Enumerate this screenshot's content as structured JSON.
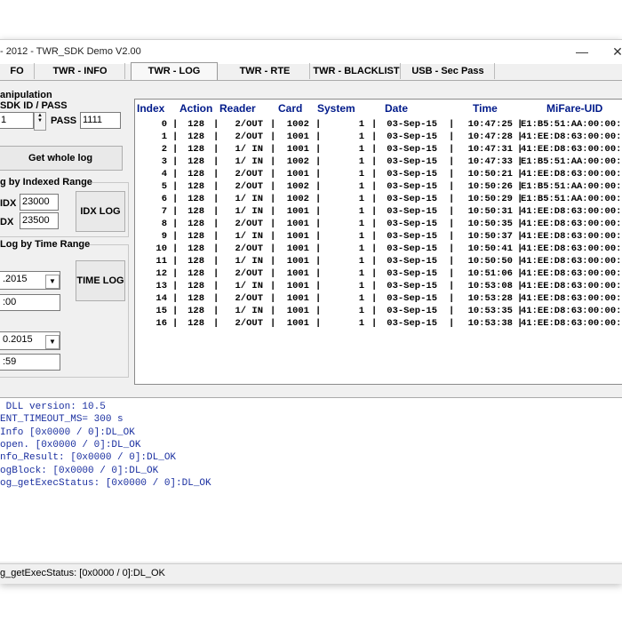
{
  "window": {
    "title": "- 2012  - TWR_SDK Demo V2.00",
    "minimize": "—",
    "close": "✕"
  },
  "tabs": [
    {
      "label": "FO"
    },
    {
      "label": "TWR - INFO"
    },
    {
      "label": "TWR - LOG"
    },
    {
      "label": "TWR - RTE"
    },
    {
      "label": "TWR - BLACKLIST"
    },
    {
      "label": "USB - Sec Pass"
    }
  ],
  "left": {
    "manipulation_title": "anipulation",
    "sdk_id_pass_label": "SDK ID / PASS",
    "sdk_id_value": "1",
    "pass_label": "PASS",
    "pass_value": "1111",
    "get_whole_log": "Get whole log",
    "indexed_title": "g by Indexed Range",
    "idx_from_label": "IDX",
    "idx_from_value": "23000",
    "idx_to_label": "DX",
    "idx_to_value": "23500",
    "idx_log_button": "IDX LOG",
    "time_title": "Log by Time Range",
    "date_from": ".2015",
    "time_from": ":00",
    "time_log_button": "TIME LOG",
    "date_to": "0.2015",
    "time_to": ":59"
  },
  "log": {
    "columns": [
      "Index",
      "Action",
      "Reader",
      "Card",
      "System",
      "Date",
      "Time",
      "MiFare-UID"
    ],
    "rows": [
      [
        "0",
        "128",
        "2/OUT",
        "1002",
        "1",
        "03-Sep-15",
        "10:47:25",
        "E1:B5:51:AA:00:00:"
      ],
      [
        "1",
        "128",
        "2/OUT",
        "1001",
        "1",
        "03-Sep-15",
        "10:47:28",
        "41:EE:D8:63:00:00:"
      ],
      [
        "2",
        "128",
        "1/ IN",
        "1001",
        "1",
        "03-Sep-15",
        "10:47:31",
        "41:EE:D8:63:00:00:"
      ],
      [
        "3",
        "128",
        "1/ IN",
        "1002",
        "1",
        "03-Sep-15",
        "10:47:33",
        "E1:B5:51:AA:00:00:"
      ],
      [
        "4",
        "128",
        "2/OUT",
        "1001",
        "1",
        "03-Sep-15",
        "10:50:21",
        "41:EE:D8:63:00:00:"
      ],
      [
        "5",
        "128",
        "2/OUT",
        "1002",
        "1",
        "03-Sep-15",
        "10:50:26",
        "E1:B5:51:AA:00:00:"
      ],
      [
        "6",
        "128",
        "1/ IN",
        "1002",
        "1",
        "03-Sep-15",
        "10:50:29",
        "E1:B5:51:AA:00:00:"
      ],
      [
        "7",
        "128",
        "1/ IN",
        "1001",
        "1",
        "03-Sep-15",
        "10:50:31",
        "41:EE:D8:63:00:00:"
      ],
      [
        "8",
        "128",
        "2/OUT",
        "1001",
        "1",
        "03-Sep-15",
        "10:50:35",
        "41:EE:D8:63:00:00:"
      ],
      [
        "9",
        "128",
        "1/ IN",
        "1001",
        "1",
        "03-Sep-15",
        "10:50:37",
        "41:EE:D8:63:00:00:"
      ],
      [
        "10",
        "128",
        "2/OUT",
        "1001",
        "1",
        "03-Sep-15",
        "10:50:41",
        "41:EE:D8:63:00:00:"
      ],
      [
        "11",
        "128",
        "1/ IN",
        "1001",
        "1",
        "03-Sep-15",
        "10:50:50",
        "41:EE:D8:63:00:00:"
      ],
      [
        "12",
        "128",
        "2/OUT",
        "1001",
        "1",
        "03-Sep-15",
        "10:51:06",
        "41:EE:D8:63:00:00:"
      ],
      [
        "13",
        "128",
        "1/ IN",
        "1001",
        "1",
        "03-Sep-15",
        "10:53:08",
        "41:EE:D8:63:00:00:"
      ],
      [
        "14",
        "128",
        "2/OUT",
        "1001",
        "1",
        "03-Sep-15",
        "10:53:28",
        "41:EE:D8:63:00:00:"
      ],
      [
        "15",
        "128",
        "1/ IN",
        "1001",
        "1",
        "03-Sep-15",
        "10:53:35",
        "41:EE:D8:63:00:00:"
      ],
      [
        "16",
        "128",
        "2/OUT",
        "1001",
        "1",
        "03-Sep-15",
        "10:53:38",
        "41:EE:D8:63:00:00:"
      ]
    ]
  },
  "console": {
    "lines": [
      " DLL version: 10.5",
      "ENT_TIMEOUT_MS= 300 s",
      "Info [0x0000 / 0]:DL_OK",
      "open. [0x0000 / 0]:DL_OK",
      "nfo_Result: [0x0000 / 0]:DL_OK",
      "ogBlock: [0x0000 / 0]:DL_OK",
      "og_getExecStatus: [0x0000 / 0]:DL_OK"
    ]
  },
  "status": {
    "text": "g_getExecStatus: [0x0000 / 0]:DL_OK"
  },
  "colors": {
    "header_text": "#001a8a",
    "console_text": "#1a2fa0"
  }
}
